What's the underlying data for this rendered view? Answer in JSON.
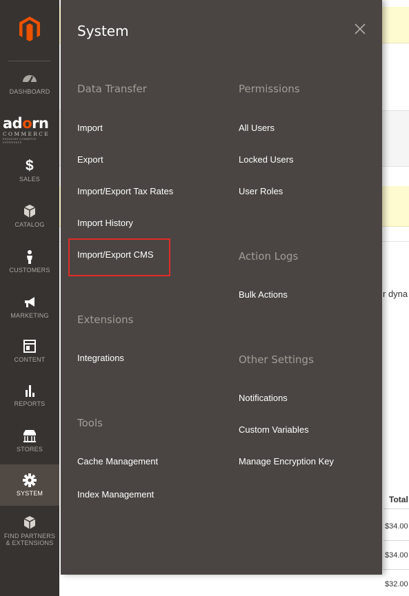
{
  "nav": {
    "items": [
      {
        "label": "DASHBOARD",
        "icon": "dashboard-icon"
      },
      {
        "label": "SALES",
        "icon": "dollar-icon"
      },
      {
        "label": "CATALOG",
        "icon": "box-icon"
      },
      {
        "label": "CUSTOMERS",
        "icon": "person-icon"
      },
      {
        "label": "MARKETING",
        "icon": "megaphone-icon"
      },
      {
        "label": "CONTENT",
        "icon": "layout-icon"
      },
      {
        "label": "REPORTS",
        "icon": "bar-chart-icon"
      },
      {
        "label": "STORES",
        "icon": "storefront-icon"
      },
      {
        "label": "SYSTEM",
        "icon": "gear-icon"
      },
      {
        "label_line1": "FIND PARTNERS",
        "label_line2": "& EXTENSIONS",
        "icon": "partners-box-icon"
      }
    ],
    "active": "SYSTEM",
    "brand": {
      "word_a": "ad",
      "word_o": "o",
      "word_b": "rn",
      "sub": "COMMERCE",
      "tag": "ENGAGING COMMERCE EXPERIENCE"
    }
  },
  "panel": {
    "title": "System",
    "sections": {
      "data_transfer": {
        "title": "Data Transfer",
        "links": [
          "Import",
          "Export",
          "Import/Export Tax Rates",
          "Import History",
          "Import/Export CMS"
        ]
      },
      "extensions": {
        "title": "Extensions",
        "links": [
          "Integrations"
        ]
      },
      "tools": {
        "title": "Tools",
        "links": [
          "Cache Management",
          "Index Management"
        ]
      },
      "permissions": {
        "title": "Permissions",
        "links": [
          "All Users",
          "Locked Users",
          "User Roles"
        ]
      },
      "action_logs": {
        "title": "Action Logs",
        "links": [
          "Bulk Actions"
        ]
      },
      "other_settings": {
        "title": "Other Settings",
        "links": [
          "Notifications",
          "Custom Variables",
          "Manage Encryption Key"
        ]
      }
    },
    "highlighted": "Import/Export CMS"
  },
  "background": {
    "partial_text": "r dyna",
    "column_header": "Total",
    "rows": [
      "$34.00",
      "$34.00",
      "$32.00"
    ]
  },
  "colors": {
    "nav_bg": "#373330",
    "panel_bg": "#4a4542",
    "brand_orange": "#eb5202",
    "highlight_red": "#e02b27"
  }
}
